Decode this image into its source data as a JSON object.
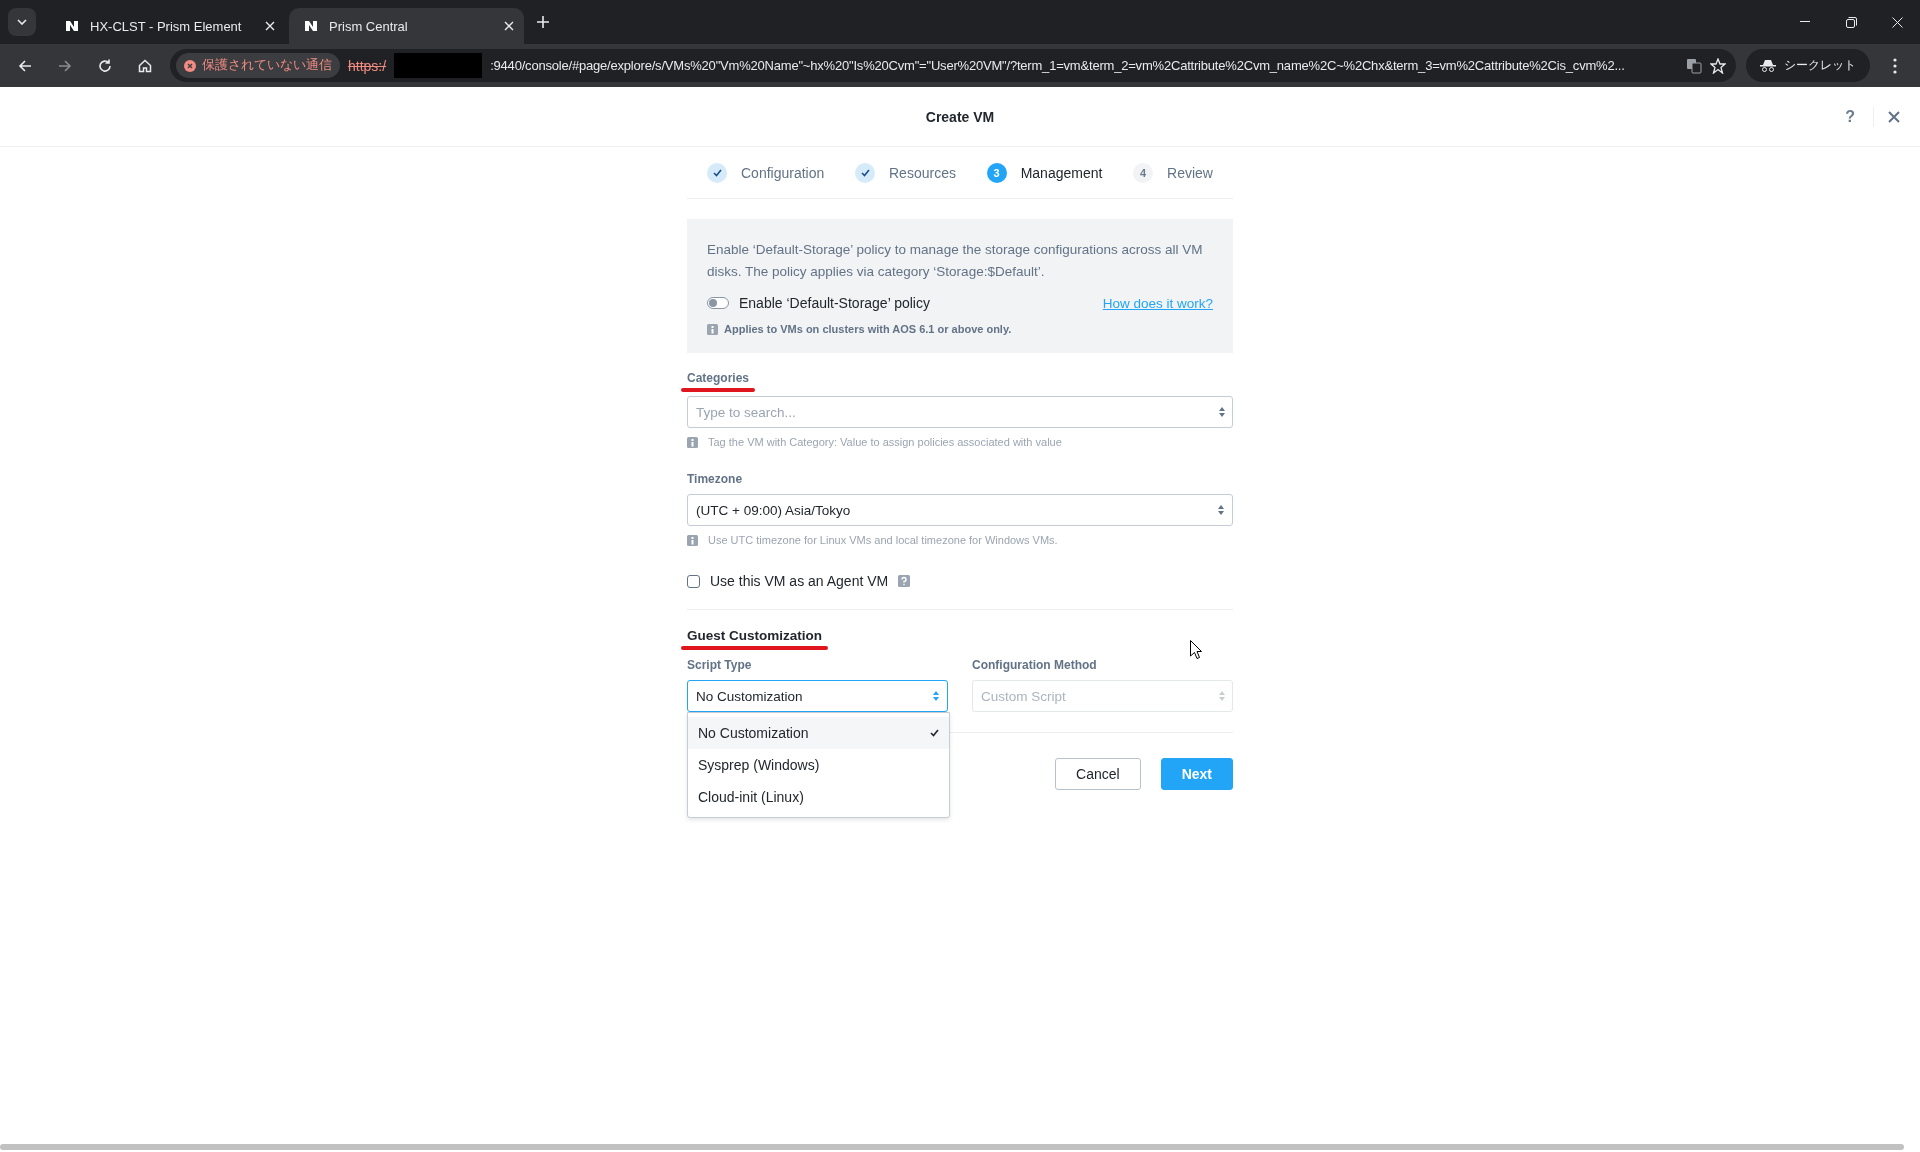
{
  "browser": {
    "tabs": [
      {
        "title": "HX-CLST - Prism Element",
        "selected": false
      },
      {
        "title": "Prism Central",
        "selected": true
      }
    ],
    "security_label": "保護されていない通信",
    "url": {
      "protocol": "https:/",
      "rest": ":9440/console/#page/explore/s/VMs%20\"Vm%20Name\"~hx%20\"Is%20Cvm\"=\"User%20VM\"/?term_1=vm&term_2=vm%2Cattribute%2Cvm_name%2C~%2Chx&term_3=vm%2Cattribute%2Cis_cvm%2..."
    },
    "profile_label": "シークレット"
  },
  "modal": {
    "title": "Create VM",
    "help": "?",
    "steps": [
      {
        "label": "Configuration",
        "completed": true,
        "selected": false
      },
      {
        "label": "Resources",
        "completed": true,
        "selected": false
      },
      {
        "number": "3",
        "label": "Management",
        "completed": false,
        "selected": true
      },
      {
        "number": "4",
        "label": "Review",
        "completed": false,
        "selected": false
      }
    ],
    "storage_policy": {
      "description": "Enable ‘Default-Storage’ policy to manage the storage configurations across all VM disks. The policy applies via category ‘Storage:$Default’.",
      "toggle_label": "Enable ‘Default-Storage’ policy",
      "on": false,
      "link": "How does it work?",
      "note": "Applies to VMs on clusters with AOS 6.1 or above only."
    },
    "categories": {
      "label": "Categories",
      "placeholder": "Type to search...",
      "hint": "Tag the VM with Category: Value to assign policies associated with value"
    },
    "timezone": {
      "label": "Timezone",
      "value": "(UTC + 09:00) Asia/Tokyo",
      "hint": "Use UTC timezone for Linux VMs and local timezone for Windows VMs."
    },
    "agent_vm": {
      "label": "Use this VM as an Agent VM",
      "checked": false
    },
    "guest_customization": {
      "title": "Guest Customization",
      "script_type": {
        "label": "Script Type",
        "value": "No Customization",
        "open": true,
        "options": [
          {
            "label": "No Customization",
            "selected": true
          },
          {
            "label": "Sysprep (Windows)",
            "selected": false
          },
          {
            "label": "Cloud-init (Linux)",
            "selected": false
          }
        ]
      },
      "configuration_method": {
        "label": "Configuration Method",
        "placeholder": "Custom Script",
        "disabled": true
      }
    },
    "buttons": [
      {
        "label": "Cancel",
        "kind": "secondary"
      },
      {
        "label": "Next",
        "kind": "primary"
      }
    ]
  }
}
